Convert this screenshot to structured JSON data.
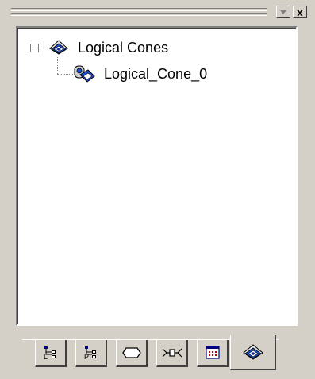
{
  "window": {
    "dropdown_icon": "dropdown-arrow-icon",
    "close_label": "x"
  },
  "tree": {
    "root": {
      "label": "Logical Cones",
      "expanded": true,
      "icon": "logical-cones-icon"
    },
    "children": [
      {
        "label": "Logical_Cone_0",
        "icon": "logical-cone-item-icon"
      }
    ]
  },
  "tabs": [
    {
      "name": "logical-tree",
      "icon": "logical-tree-icon"
    },
    {
      "name": "physical-tree",
      "icon": "physical-tree-icon"
    },
    {
      "name": "shapes",
      "icon": "hexagon-icon"
    },
    {
      "name": "connections",
      "icon": "connector-icon"
    },
    {
      "name": "components",
      "icon": "component-icon"
    },
    {
      "name": "logical-cones",
      "icon": "logical-cones-icon",
      "active": true
    }
  ]
}
